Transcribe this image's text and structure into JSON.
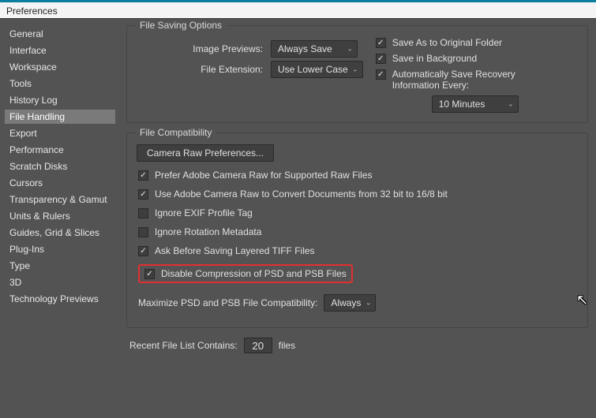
{
  "window": {
    "title": "Preferences"
  },
  "sidebar": {
    "items": [
      {
        "label": "General"
      },
      {
        "label": "Interface"
      },
      {
        "label": "Workspace"
      },
      {
        "label": "Tools"
      },
      {
        "label": "History Log"
      },
      {
        "label": "File Handling"
      },
      {
        "label": "Export"
      },
      {
        "label": "Performance"
      },
      {
        "label": "Scratch Disks"
      },
      {
        "label": "Cursors"
      },
      {
        "label": "Transparency & Gamut"
      },
      {
        "label": "Units & Rulers"
      },
      {
        "label": "Guides, Grid & Slices"
      },
      {
        "label": "Plug-Ins"
      },
      {
        "label": "Type"
      },
      {
        "label": "3D"
      },
      {
        "label": "Technology Previews"
      }
    ],
    "activeIndex": 5
  },
  "saving": {
    "legend": "File Saving Options",
    "previews_label": "Image Previews:",
    "previews_value": "Always Save",
    "extension_label": "File Extension:",
    "extension_value": "Use Lower Case",
    "save_original_label": "Save As to Original Folder",
    "save_bg_label": "Save in Background",
    "auto_save_label": "Automatically Save Recovery Information Every:",
    "auto_save_interval": "10 Minutes"
  },
  "compat": {
    "legend": "File Compatibility",
    "camera_raw_btn": "Camera Raw Preferences...",
    "prefer_acr_label": "Prefer Adobe Camera Raw for Supported Raw Files",
    "use_acr_32_label": "Use Adobe Camera Raw to Convert Documents from 32 bit to 16/8 bit",
    "ignore_exif_label": "Ignore EXIF Profile Tag",
    "ignore_rotation_label": "Ignore Rotation Metadata",
    "ask_tiff_label": "Ask Before Saving Layered TIFF Files",
    "disable_compression_label": "Disable Compression of PSD and PSB Files",
    "maximize_label": "Maximize PSD and PSB File Compatibility:",
    "maximize_value": "Always"
  },
  "recent": {
    "label": "Recent File List Contains:",
    "value": "20",
    "suffix": "files"
  }
}
